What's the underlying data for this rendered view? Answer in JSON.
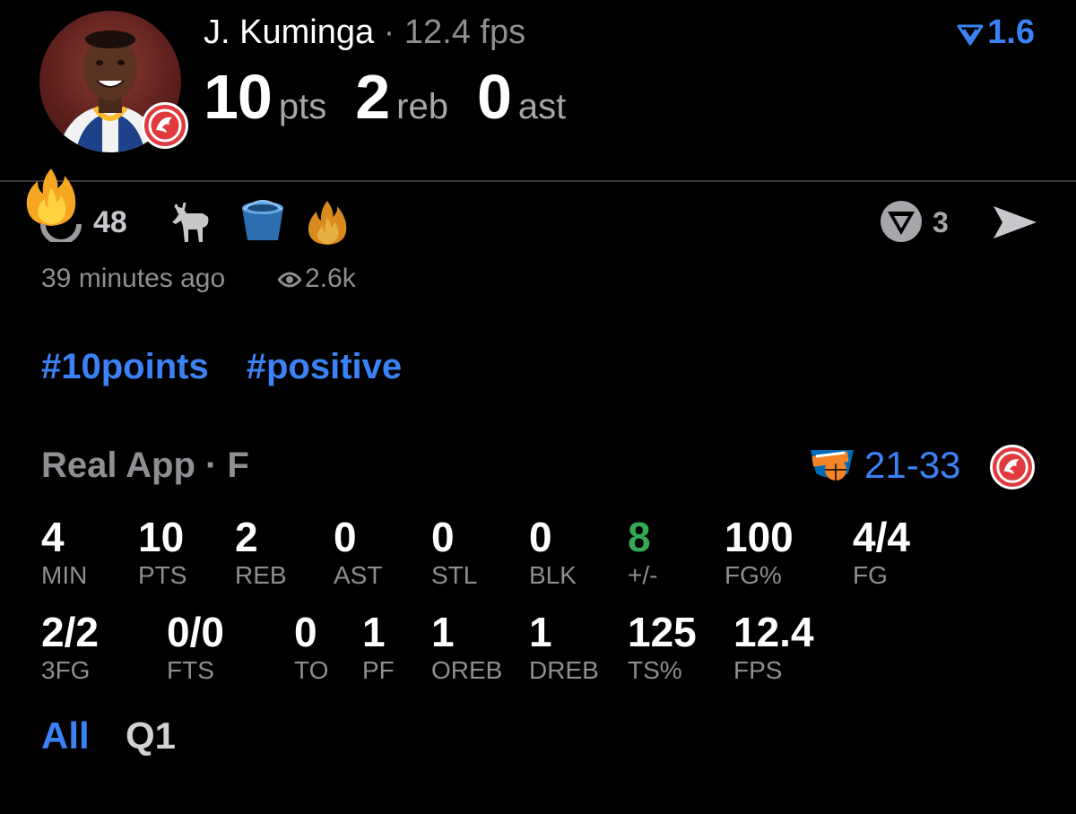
{
  "header": {
    "player_name": "J. Kuminga",
    "separator": " · ",
    "fps_label": "12.4 fps",
    "rating": "1.6",
    "stats": [
      {
        "value": "10",
        "unit": "pts"
      },
      {
        "value": "2",
        "unit": "reb"
      },
      {
        "value": "0",
        "unit": "ast"
      }
    ]
  },
  "reactions": {
    "count": "48",
    "share_count": "3",
    "icons": [
      "fire-icon",
      "goat-icon",
      "bucket-icon",
      "fire-icon"
    ]
  },
  "meta": {
    "time_ago": "39 minutes ago",
    "views": "2.6k"
  },
  "tags": [
    "#10points",
    "#positive"
  ],
  "game": {
    "title": "Real App · F",
    "score": "21-33"
  },
  "stats_row1": [
    {
      "value": "4",
      "label": "MIN"
    },
    {
      "value": "10",
      "label": "PTS"
    },
    {
      "value": "2",
      "label": "REB"
    },
    {
      "value": "0",
      "label": "AST"
    },
    {
      "value": "0",
      "label": "STL"
    },
    {
      "value": "0",
      "label": "BLK"
    },
    {
      "value": "8",
      "label": "+/-"
    },
    {
      "value": "100",
      "label": "FG%"
    },
    {
      "value": "4/4",
      "label": "FG"
    }
  ],
  "stats_row2": [
    {
      "value": "2/2",
      "label": "3FG"
    },
    {
      "value": "0/0",
      "label": "FTS"
    },
    {
      "value": "0",
      "label": "TO"
    },
    {
      "value": "1",
      "label": "PF"
    },
    {
      "value": "1",
      "label": "OREB"
    },
    {
      "value": "1",
      "label": "DREB"
    },
    {
      "value": "125",
      "label": "TS%"
    },
    {
      "value": "12.4",
      "label": "FPS"
    }
  ],
  "tabs": [
    {
      "label": "All",
      "active": true
    },
    {
      "label": "Q1",
      "active": false
    }
  ],
  "colors": {
    "accent": "#3b82f6",
    "positive": "#34a853",
    "hawks_red": "#e03a3e",
    "knicks_orange": "#f58426",
    "knicks_blue": "#006bb6"
  }
}
